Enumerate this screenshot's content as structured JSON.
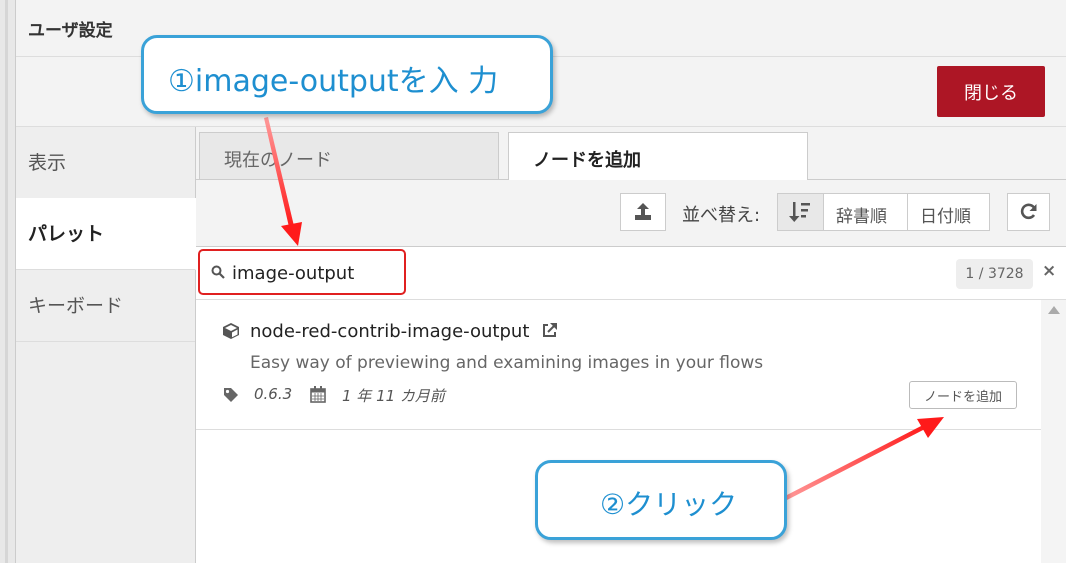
{
  "window": {
    "title": "ユーザ設定",
    "close_label": "閉じる"
  },
  "sidebar": {
    "items": [
      {
        "label": "表示",
        "active": false
      },
      {
        "label": "パレット",
        "active": true
      },
      {
        "label": "キーボード",
        "active": false
      }
    ]
  },
  "tabs": [
    {
      "label": "現在のノード"
    },
    {
      "label": "ノードを追加"
    }
  ],
  "toolbar": {
    "sort_label": "並べ替え:",
    "sort_dict": "辞書順",
    "sort_date": "日付順"
  },
  "search": {
    "value": "image-output",
    "count": "1 / 3728",
    "clear": "×"
  },
  "results": [
    {
      "name": "node-red-contrib-image-output",
      "description": "Easy way of previewing and examining images in your flows",
      "version": "0.6.3",
      "updated": "1 年 11 カ月前",
      "add_label": "ノードを追加"
    }
  ],
  "annotations": {
    "step1": "①image-outputを入 力",
    "step2": "②クリック"
  },
  "colors": {
    "close_button": "#ad1625",
    "callout_border": "#3aa2d8",
    "callout_text": "#1e8fd0",
    "highlight": "#e02020"
  },
  "icons": [
    "upload-icon",
    "sort-icon",
    "refresh-icon",
    "search-icon",
    "package-icon",
    "external-link-icon",
    "tag-icon",
    "calendar-icon"
  ]
}
